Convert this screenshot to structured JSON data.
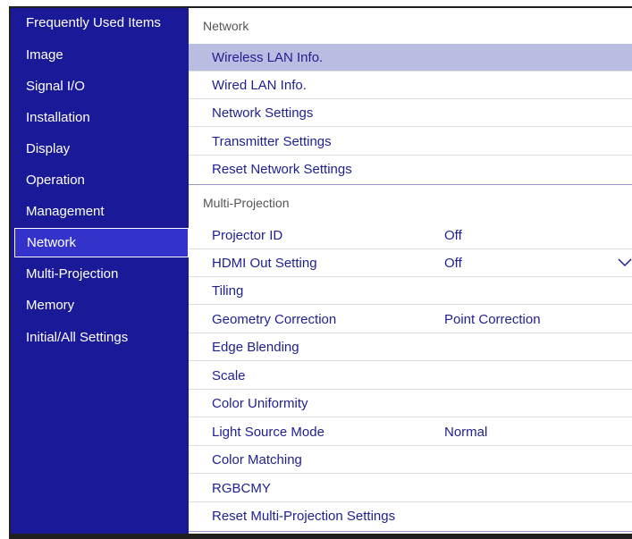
{
  "sidebar": {
    "items": [
      {
        "label": "Frequently Used Items"
      },
      {
        "label": "Image"
      },
      {
        "label": "Signal I/O"
      },
      {
        "label": "Installation"
      },
      {
        "label": "Display"
      },
      {
        "label": "Operation"
      },
      {
        "label": "Management"
      },
      {
        "label": "Network"
      },
      {
        "label": "Multi-Projection"
      },
      {
        "label": "Memory"
      },
      {
        "label": "Initial/All Settings"
      }
    ],
    "selected": "Network"
  },
  "network": {
    "header": "Network",
    "items": [
      {
        "label": "Wireless LAN Info."
      },
      {
        "label": "Wired LAN Info."
      },
      {
        "label": "Network Settings"
      },
      {
        "label": "Transmitter Settings"
      },
      {
        "label": "Reset Network Settings"
      }
    ],
    "selected": "Wireless LAN Info."
  },
  "multi_projection": {
    "header": "Multi-Projection",
    "items": [
      {
        "label": "Projector ID",
        "value": "Off"
      },
      {
        "label": "HDMI Out Setting",
        "value": "Off",
        "icon": "chevron-down-icon"
      },
      {
        "label": "Tiling"
      },
      {
        "label": "Geometry Correction",
        "value": "Point Correction"
      },
      {
        "label": "Edge Blending"
      },
      {
        "label": "Scale"
      },
      {
        "label": "Color Uniformity"
      },
      {
        "label": "Light Source Mode",
        "value": "Normal"
      },
      {
        "label": "Color Matching"
      },
      {
        "label": "RGBCMY"
      },
      {
        "label": "Reset Multi-Projection Settings"
      }
    ]
  },
  "colors": {
    "sidebar_bg": "#1a1a99",
    "sidebar_selected": "#3333cc",
    "row_selected": "#b9bde1",
    "row_text": "#1f1f8f"
  }
}
